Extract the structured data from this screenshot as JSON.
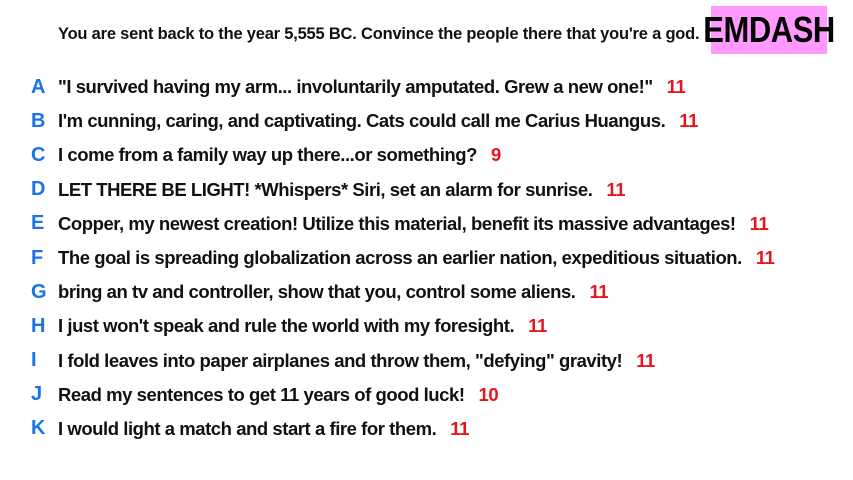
{
  "prompt": "You are sent back to the year 5,555 BC. Convince the people there that you're a god.",
  "logo": "EMDASH",
  "colors": {
    "letter": "#1a73e8",
    "score": "#e8141c",
    "logo_bg": "#ff99ff"
  },
  "answers": [
    {
      "letter": "A",
      "text": "\"I survived having my arm... involuntarily amputated. Grew a new one!\"",
      "score": "11"
    },
    {
      "letter": "B",
      "text": "I'm cunning, caring, and captivating. Cats could call me Carius Huangus.",
      "score": "11"
    },
    {
      "letter": "C",
      "text": "I come from a family way up there...or something?",
      "score": "9"
    },
    {
      "letter": "D",
      "text": "LET THERE BE LIGHT! *Whispers* Siri, set an alarm for sunrise.",
      "score": "11"
    },
    {
      "letter": "E",
      "text": "Copper, my newest creation! Utilize this material, benefit its massive advantages!",
      "score": "11"
    },
    {
      "letter": "F",
      "text": "The goal is spreading globalization across an earlier nation, expeditious situation.",
      "score": "11"
    },
    {
      "letter": "G",
      "text": "bring an tv and controller, show that you, control some aliens.",
      "score": "11"
    },
    {
      "letter": "H",
      "text": "I just won't speak and rule the world with my foresight.",
      "score": "11"
    },
    {
      "letter": "I",
      "text": "I fold leaves into paper airplanes and throw them, \"defying\" gravity!",
      "score": "11"
    },
    {
      "letter": "J",
      "text": "Read my sentences to get 11 years of good luck!",
      "score": "10"
    },
    {
      "letter": "K",
      "text": "I would light a match and start a fire for them.",
      "score": "11"
    }
  ]
}
